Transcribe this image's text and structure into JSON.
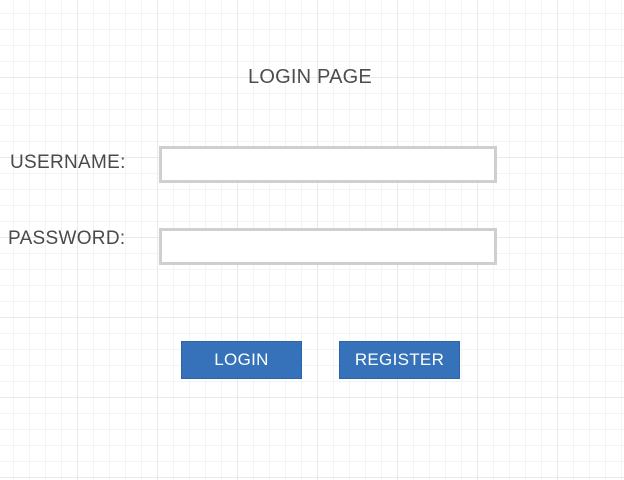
{
  "page": {
    "title": "LOGIN PAGE"
  },
  "form": {
    "username_label": "USERNAME:",
    "username_value": "",
    "password_label": "PASSWORD:",
    "password_value": ""
  },
  "actions": {
    "login_label": "LOGIN",
    "register_label": "REGISTER"
  },
  "colors": {
    "button_bg": "#3572ba",
    "field_border": "#cfcfcf",
    "text": "#4d4d4d"
  }
}
